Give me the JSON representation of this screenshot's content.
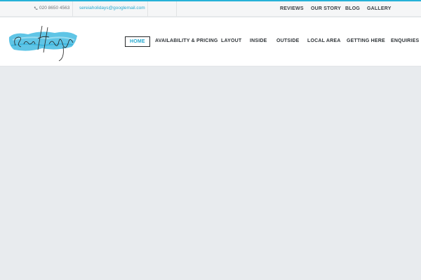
{
  "topbar": {
    "phone": "020 8650 4563",
    "email": "sereiaholidays@googlemail.com",
    "links": [
      "REVIEWS",
      "OUR STORY",
      "BLOG",
      "GALLERY"
    ]
  },
  "logo": {
    "text": "Sereia Holidays"
  },
  "nav": {
    "items": [
      "HOME",
      "AVAILABILITY & PRICING",
      "LAYOUT",
      "INSIDE",
      "OUTSIDE",
      "LOCAL AREA",
      "GETTING HERE",
      "ENQUIRIES"
    ],
    "active": "HOME"
  },
  "colors": {
    "accent": "#27b2d8",
    "background": "#e8ebee",
    "header": "#ffffff"
  }
}
